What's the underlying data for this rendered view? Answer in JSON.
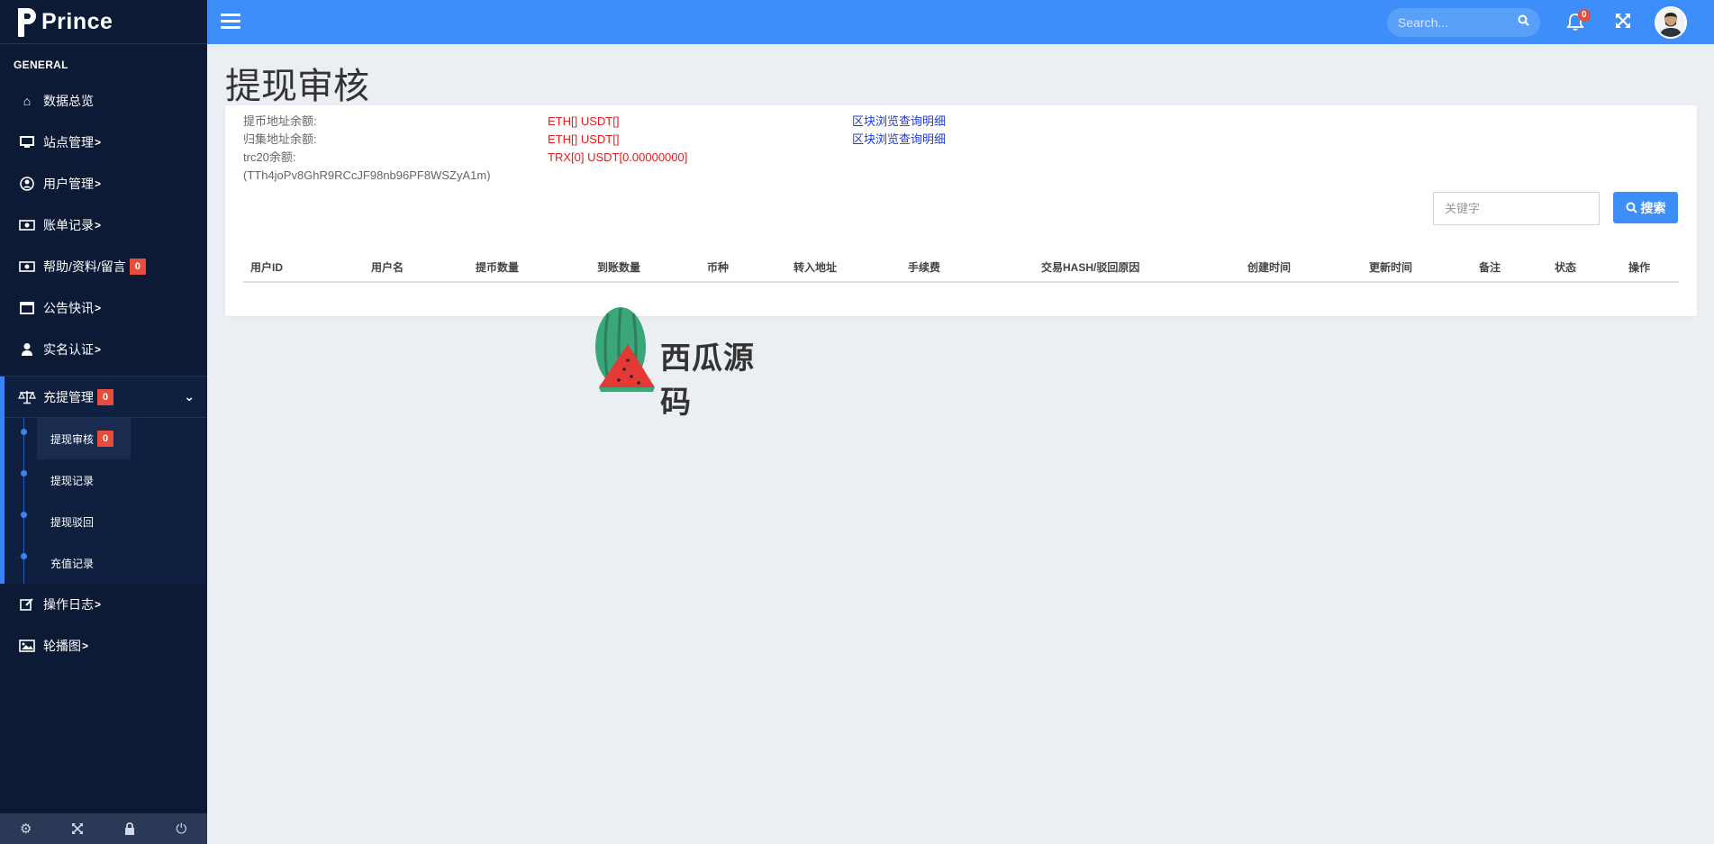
{
  "brand": {
    "name": "Prince"
  },
  "sidebar": {
    "section": "GENERAL",
    "items": [
      {
        "label": "数据总览",
        "icon": "home-icon",
        "caret": ""
      },
      {
        "label": "站点管理",
        "icon": "monitor-icon",
        "caret": ">"
      },
      {
        "label": "用户管理",
        "icon": "user-circle-icon",
        "caret": ">"
      },
      {
        "label": "账单记录",
        "icon": "money-icon",
        "caret": ">"
      },
      {
        "label": "帮助/资料/留言",
        "icon": "money-icon",
        "caret": "",
        "badge": "0"
      },
      {
        "label": "公告快讯",
        "icon": "window-icon",
        "caret": ">"
      },
      {
        "label": "实名认证",
        "icon": "user-icon",
        "caret": ">"
      }
    ],
    "group": {
      "label": "充提管理",
      "badge": "0",
      "icon": "balance-scale-icon",
      "children": [
        {
          "label": "提现审核",
          "badge": "0",
          "active": true
        },
        {
          "label": "提现记录"
        },
        {
          "label": "提现驳回"
        },
        {
          "label": "充值记录"
        }
      ]
    },
    "items_after": [
      {
        "label": "操作日志",
        "icon": "edit-icon",
        "caret": ">"
      },
      {
        "label": "轮播图",
        "icon": "image-icon",
        "caret": ">"
      }
    ],
    "footer": [
      "gear-icon",
      "expand-icon",
      "lock-icon",
      "power-icon"
    ]
  },
  "topbar": {
    "search_placeholder": "Search...",
    "notification_count": "0"
  },
  "page": {
    "title": "提现审核",
    "info": {
      "row1": {
        "label": "提币地址余额:",
        "value": "ETH[] USDT[]",
        "link": "区块浏览查询明细"
      },
      "row2": {
        "label": "归集地址余额:",
        "value": "ETH[] USDT[]",
        "link": "区块浏览查询明细"
      },
      "row3": {
        "label": "trc20余额:",
        "value": "TRX[0] USDT[0.00000000]"
      },
      "row4": {
        "label": "(TTh4joPv8GhR9RCcJF98nb96PF8WSZyA1m)"
      }
    },
    "keyword_placeholder": "关键字",
    "search_button": "搜索",
    "table_headers": [
      "用户ID",
      "用户名",
      "提币数量",
      "到账数量",
      "币种",
      "转入地址",
      "手续费",
      "交易HASH/驳回原因",
      "创建时间",
      "更新时间",
      "备注",
      "状态",
      "操作"
    ]
  },
  "watermark": {
    "text": "西瓜源码"
  },
  "colors": {
    "sidebar_bg": "#0c1a35",
    "topbar": "#3d8ef8",
    "badge": "#e74c3c",
    "red_text": "#e02020",
    "link": "#1f3bd6"
  }
}
